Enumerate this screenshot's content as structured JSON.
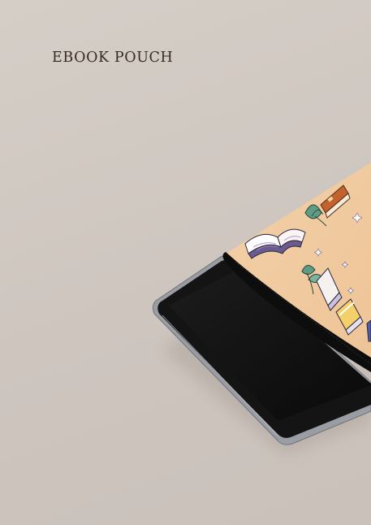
{
  "product": {
    "title": "EBOOK POUCH"
  },
  "colors": {
    "background": "#d0c8c1",
    "title_text": "#3a2a24",
    "pouch_fabric": "#f1cba0",
    "tablet_bezel": "#151515",
    "tablet_frame": "#8a8d93",
    "zipper": "#0c0c0c"
  },
  "illustrations": [
    "book-icon",
    "open-book-icon",
    "leaf-icon",
    "sparkle-icon"
  ]
}
